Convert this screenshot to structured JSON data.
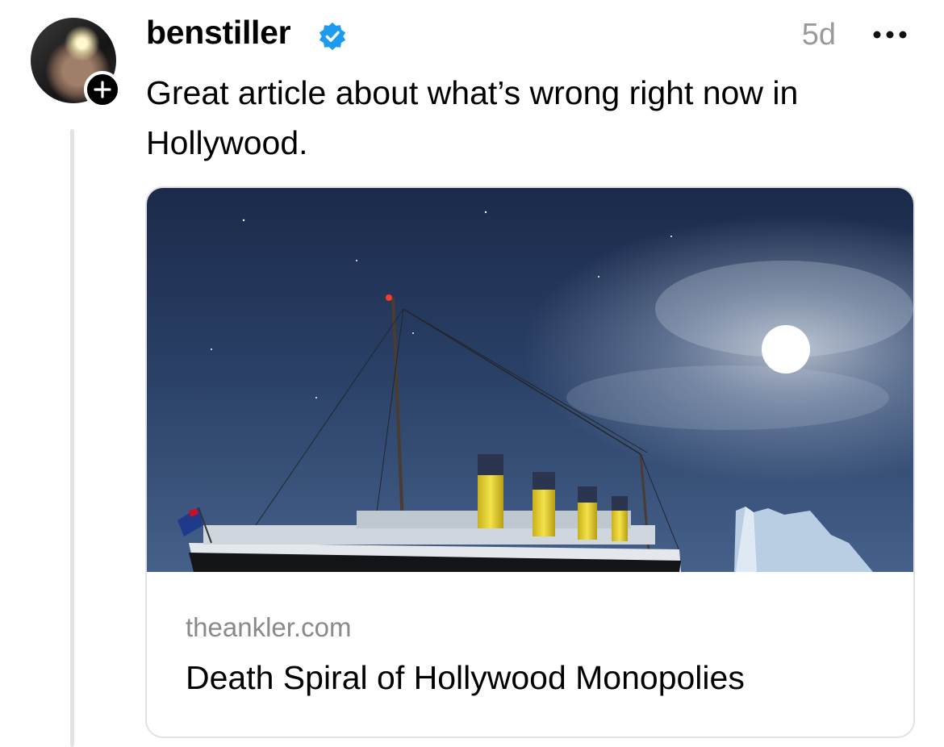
{
  "post": {
    "username": "benstiller",
    "verified_icon": "verified-badge-icon",
    "timestamp": "5d",
    "text": "Great article about what’s wrong right now in Hollywood.",
    "avatar": {
      "follow_badge_icon": "plus-icon"
    },
    "more_icon": "more-horizontal-icon"
  },
  "link_card": {
    "image_icon": "titanic-ship-night-image",
    "domain": "theankler.com",
    "headline": "Death Spiral of Hollywood Monopolies"
  },
  "colors": {
    "verified_blue": "#1d9bf0",
    "thread_line": "#e3e3e3",
    "secondary_text": "#8a8a8a"
  }
}
